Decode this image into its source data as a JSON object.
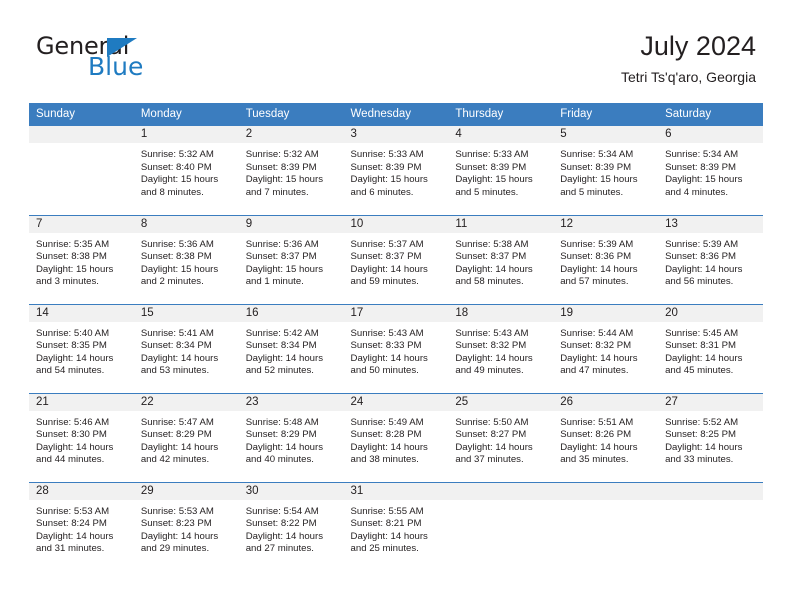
{
  "brand": {
    "name_part1": "General",
    "name_part2": "Blue",
    "accent_color": "#1f7bc1"
  },
  "header": {
    "title": "July 2024",
    "subtitle": "Tetri Ts'q'aro, Georgia",
    "header_bg_color": "#3b7dbf",
    "daynum_bg_color": "#f1f1f1"
  },
  "weekday_headers": [
    "Sunday",
    "Monday",
    "Tuesday",
    "Wednesday",
    "Thursday",
    "Friday",
    "Saturday"
  ],
  "weeks": [
    [
      {
        "day": "",
        "blank": true,
        "sunrise": "",
        "sunset": "",
        "daylight": ""
      },
      {
        "day": "1",
        "sunrise": "Sunrise: 5:32 AM",
        "sunset": "Sunset: 8:40 PM",
        "daylight": "Daylight: 15 hours and 8 minutes."
      },
      {
        "day": "2",
        "sunrise": "Sunrise: 5:32 AM",
        "sunset": "Sunset: 8:39 PM",
        "daylight": "Daylight: 15 hours and 7 minutes."
      },
      {
        "day": "3",
        "sunrise": "Sunrise: 5:33 AM",
        "sunset": "Sunset: 8:39 PM",
        "daylight": "Daylight: 15 hours and 6 minutes."
      },
      {
        "day": "4",
        "sunrise": "Sunrise: 5:33 AM",
        "sunset": "Sunset: 8:39 PM",
        "daylight": "Daylight: 15 hours and 5 minutes."
      },
      {
        "day": "5",
        "sunrise": "Sunrise: 5:34 AM",
        "sunset": "Sunset: 8:39 PM",
        "daylight": "Daylight: 15 hours and 5 minutes."
      },
      {
        "day": "6",
        "sunrise": "Sunrise: 5:34 AM",
        "sunset": "Sunset: 8:39 PM",
        "daylight": "Daylight: 15 hours and 4 minutes."
      }
    ],
    [
      {
        "day": "7",
        "sunrise": "Sunrise: 5:35 AM",
        "sunset": "Sunset: 8:38 PM",
        "daylight": "Daylight: 15 hours and 3 minutes."
      },
      {
        "day": "8",
        "sunrise": "Sunrise: 5:36 AM",
        "sunset": "Sunset: 8:38 PM",
        "daylight": "Daylight: 15 hours and 2 minutes."
      },
      {
        "day": "9",
        "sunrise": "Sunrise: 5:36 AM",
        "sunset": "Sunset: 8:37 PM",
        "daylight": "Daylight: 15 hours and 1 minute."
      },
      {
        "day": "10",
        "sunrise": "Sunrise: 5:37 AM",
        "sunset": "Sunset: 8:37 PM",
        "daylight": "Daylight: 14 hours and 59 minutes."
      },
      {
        "day": "11",
        "sunrise": "Sunrise: 5:38 AM",
        "sunset": "Sunset: 8:37 PM",
        "daylight": "Daylight: 14 hours and 58 minutes."
      },
      {
        "day": "12",
        "sunrise": "Sunrise: 5:39 AM",
        "sunset": "Sunset: 8:36 PM",
        "daylight": "Daylight: 14 hours and 57 minutes."
      },
      {
        "day": "13",
        "sunrise": "Sunrise: 5:39 AM",
        "sunset": "Sunset: 8:36 PM",
        "daylight": "Daylight: 14 hours and 56 minutes."
      }
    ],
    [
      {
        "day": "14",
        "sunrise": "Sunrise: 5:40 AM",
        "sunset": "Sunset: 8:35 PM",
        "daylight": "Daylight: 14 hours and 54 minutes."
      },
      {
        "day": "15",
        "sunrise": "Sunrise: 5:41 AM",
        "sunset": "Sunset: 8:34 PM",
        "daylight": "Daylight: 14 hours and 53 minutes."
      },
      {
        "day": "16",
        "sunrise": "Sunrise: 5:42 AM",
        "sunset": "Sunset: 8:34 PM",
        "daylight": "Daylight: 14 hours and 52 minutes."
      },
      {
        "day": "17",
        "sunrise": "Sunrise: 5:43 AM",
        "sunset": "Sunset: 8:33 PM",
        "daylight": "Daylight: 14 hours and 50 minutes."
      },
      {
        "day": "18",
        "sunrise": "Sunrise: 5:43 AM",
        "sunset": "Sunset: 8:32 PM",
        "daylight": "Daylight: 14 hours and 49 minutes."
      },
      {
        "day": "19",
        "sunrise": "Sunrise: 5:44 AM",
        "sunset": "Sunset: 8:32 PM",
        "daylight": "Daylight: 14 hours and 47 minutes."
      },
      {
        "day": "20",
        "sunrise": "Sunrise: 5:45 AM",
        "sunset": "Sunset: 8:31 PM",
        "daylight": "Daylight: 14 hours and 45 minutes."
      }
    ],
    [
      {
        "day": "21",
        "sunrise": "Sunrise: 5:46 AM",
        "sunset": "Sunset: 8:30 PM",
        "daylight": "Daylight: 14 hours and 44 minutes."
      },
      {
        "day": "22",
        "sunrise": "Sunrise: 5:47 AM",
        "sunset": "Sunset: 8:29 PM",
        "daylight": "Daylight: 14 hours and 42 minutes."
      },
      {
        "day": "23",
        "sunrise": "Sunrise: 5:48 AM",
        "sunset": "Sunset: 8:29 PM",
        "daylight": "Daylight: 14 hours and 40 minutes."
      },
      {
        "day": "24",
        "sunrise": "Sunrise: 5:49 AM",
        "sunset": "Sunset: 8:28 PM",
        "daylight": "Daylight: 14 hours and 38 minutes."
      },
      {
        "day": "25",
        "sunrise": "Sunrise: 5:50 AM",
        "sunset": "Sunset: 8:27 PM",
        "daylight": "Daylight: 14 hours and 37 minutes."
      },
      {
        "day": "26",
        "sunrise": "Sunrise: 5:51 AM",
        "sunset": "Sunset: 8:26 PM",
        "daylight": "Daylight: 14 hours and 35 minutes."
      },
      {
        "day": "27",
        "sunrise": "Sunrise: 5:52 AM",
        "sunset": "Sunset: 8:25 PM",
        "daylight": "Daylight: 14 hours and 33 minutes."
      }
    ],
    [
      {
        "day": "28",
        "sunrise": "Sunrise: 5:53 AM",
        "sunset": "Sunset: 8:24 PM",
        "daylight": "Daylight: 14 hours and 31 minutes."
      },
      {
        "day": "29",
        "sunrise": "Sunrise: 5:53 AM",
        "sunset": "Sunset: 8:23 PM",
        "daylight": "Daylight: 14 hours and 29 minutes."
      },
      {
        "day": "30",
        "sunrise": "Sunrise: 5:54 AM",
        "sunset": "Sunset: 8:22 PM",
        "daylight": "Daylight: 14 hours and 27 minutes."
      },
      {
        "day": "31",
        "sunrise": "Sunrise: 5:55 AM",
        "sunset": "Sunset: 8:21 PM",
        "daylight": "Daylight: 14 hours and 25 minutes."
      },
      {
        "day": "",
        "blank": true,
        "sunrise": "",
        "sunset": "",
        "daylight": ""
      },
      {
        "day": "",
        "blank": true,
        "sunrise": "",
        "sunset": "",
        "daylight": ""
      },
      {
        "day": "",
        "blank": true,
        "sunrise": "",
        "sunset": "",
        "daylight": ""
      }
    ]
  ]
}
